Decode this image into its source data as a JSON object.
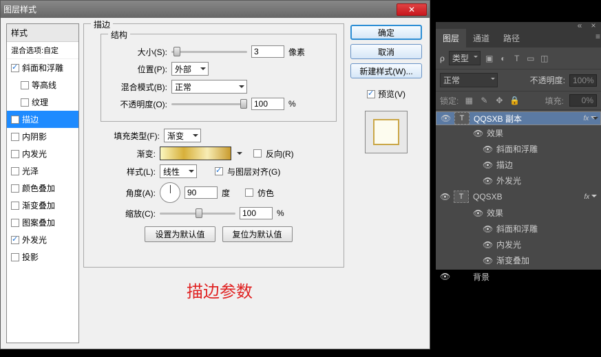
{
  "dialog": {
    "title": "图层样式",
    "list_header": "样式",
    "list_subheader": "混合选项:自定",
    "styles": [
      {
        "label": "斜面和浮雕",
        "checked": true,
        "selected": false,
        "indent": false
      },
      {
        "label": "等高线",
        "checked": false,
        "selected": false,
        "indent": true
      },
      {
        "label": "纹理",
        "checked": false,
        "selected": false,
        "indent": true
      },
      {
        "label": "描边",
        "checked": true,
        "selected": true,
        "indent": false
      },
      {
        "label": "内阴影",
        "checked": false,
        "selected": false,
        "indent": false
      },
      {
        "label": "内发光",
        "checked": false,
        "selected": false,
        "indent": false
      },
      {
        "label": "光泽",
        "checked": false,
        "selected": false,
        "indent": false
      },
      {
        "label": "颜色叠加",
        "checked": false,
        "selected": false,
        "indent": false
      },
      {
        "label": "渐变叠加",
        "checked": false,
        "selected": false,
        "indent": false
      },
      {
        "label": "图案叠加",
        "checked": false,
        "selected": false,
        "indent": false
      },
      {
        "label": "外发光",
        "checked": true,
        "selected": false,
        "indent": false
      },
      {
        "label": "投影",
        "checked": false,
        "selected": false,
        "indent": false
      }
    ],
    "group_stroke": "描边",
    "group_structure": "结构",
    "size_label": "大小(S):",
    "size_value": "3",
    "size_unit": "像素",
    "position_label": "位置(P):",
    "position_value": "外部",
    "blend_label": "混合模式(B):",
    "blend_value": "正常",
    "opacity_label": "不透明度(O):",
    "opacity_value": "100",
    "percent": "%",
    "filltype_label": "填充类型(F):",
    "filltype_value": "渐变",
    "gradient_label": "渐变:",
    "reverse_label": "反向(R)",
    "style_label": "样式(L):",
    "style_value": "线性",
    "align_label": "与图层对齐(G)",
    "angle_label": "角度(A):",
    "angle_value": "90",
    "angle_unit": "度",
    "dither_label": "仿色",
    "scale_label": "缩放(C):",
    "scale_value": "100",
    "btn_default": "设置为默认值",
    "btn_reset": "复位为默认值",
    "note": "描边参数",
    "cmd_ok": "确定",
    "cmd_cancel": "取消",
    "cmd_new": "新建样式(W)...",
    "preview_label": "预览(V)"
  },
  "panel": {
    "tabs": [
      "图层",
      "通道",
      "路径"
    ],
    "kind_label": "类型",
    "mode": "正常",
    "opacity_label": "不透明度:",
    "opacity_value": "100%",
    "lock_label": "锁定:",
    "fill_label": "填充:",
    "fill_value": "0%",
    "layers": [
      {
        "name": "QQSXB 副本",
        "type": "T",
        "selected": true,
        "fx": true,
        "effects_label": "效果",
        "effects": [
          "斜面和浮雕",
          "描边",
          "外发光"
        ]
      },
      {
        "name": "QQSXB",
        "type": "T",
        "selected": false,
        "fx": true,
        "effects_label": "效果",
        "effects": [
          "斜面和浮雕",
          "内发光",
          "渐变叠加"
        ]
      },
      {
        "name": "背景",
        "type": "bg",
        "selected": false,
        "fx": false
      }
    ]
  }
}
